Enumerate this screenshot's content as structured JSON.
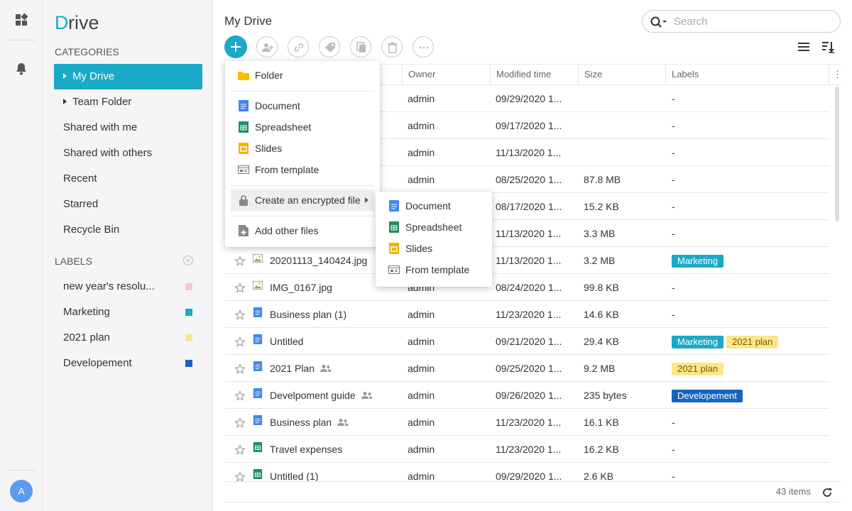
{
  "app": {
    "logo_text": "Drive",
    "user_initial": "A"
  },
  "colors": {
    "accent": "#1aa9c7",
    "marketing": "#1aa9c7",
    "plan2021": "#fde68a",
    "developement": "#1565c0",
    "newyear": "#f8c8c8"
  },
  "sidebar": {
    "categories_title": "CATEGORIES",
    "nav": [
      {
        "label": "My Drive",
        "active": true,
        "expandable": true
      },
      {
        "label": "Team Folder",
        "expandable": true
      },
      {
        "label": "Shared with me"
      },
      {
        "label": "Shared with others"
      },
      {
        "label": "Recent"
      },
      {
        "label": "Starred"
      },
      {
        "label": "Recycle Bin"
      }
    ],
    "labels_title": "LABELS",
    "labels": [
      {
        "label": "new year's resolu...",
        "color": "#f8c8c8"
      },
      {
        "label": "Marketing",
        "color": "#1aa9c7"
      },
      {
        "label": "2021 plan",
        "color": "#fde68a"
      },
      {
        "label": "Developement",
        "color": "#1565c0"
      }
    ]
  },
  "main": {
    "title": "My Drive",
    "search_placeholder": "Search",
    "columns": {
      "owner": "Owner",
      "modified": "Modified time",
      "size": "Size",
      "labels": "Labels"
    },
    "rows": [
      {
        "name": "",
        "type": "folder",
        "owner": "admin",
        "modified": "09/29/2020 1...",
        "size": "",
        "labels": []
      },
      {
        "name": "",
        "type": "folder",
        "owner": "admin",
        "modified": "09/17/2020 1...",
        "size": "",
        "labels": []
      },
      {
        "name": "",
        "type": "folder",
        "owner": "admin",
        "modified": "11/13/2020 1...",
        "size": "",
        "labels": []
      },
      {
        "name": "",
        "type": "doc",
        "owner": "admin",
        "modified": "08/25/2020 1...",
        "size": "87.8 MB",
        "labels": []
      },
      {
        "name": "",
        "type": "doc",
        "owner": "admin",
        "modified": "08/17/2020 1...",
        "size": "15.2 KB",
        "labels": []
      },
      {
        "name": "",
        "type": "doc",
        "owner": "admin",
        "modified": "11/13/2020 1...",
        "size": "3.3 MB",
        "labels": []
      },
      {
        "name": "20201113_140424.jpg",
        "type": "image",
        "owner": "admin",
        "modified": "11/13/2020 1...",
        "size": "3.2 MB",
        "labels": [
          "Marketing"
        ]
      },
      {
        "name": "IMG_0167.jpg",
        "type": "image",
        "owner": "admin",
        "modified": "08/24/2020 1...",
        "size": "99.8 KB",
        "labels": []
      },
      {
        "name": "Business plan (1)",
        "type": "doc",
        "owner": "admin",
        "modified": "11/23/2020 1...",
        "size": "14.6 KB",
        "labels": []
      },
      {
        "name": "Untitled",
        "type": "doc",
        "owner": "admin",
        "modified": "09/21/2020 1...",
        "size": "29.4 KB",
        "labels": [
          "Marketing",
          "2021 plan"
        ]
      },
      {
        "name": "2021 Plan",
        "type": "doc",
        "shared": true,
        "owner": "admin",
        "modified": "09/25/2020 1...",
        "size": "9.2 MB",
        "labels": [
          "2021 plan"
        ]
      },
      {
        "name": "Develpoment guide",
        "type": "doc",
        "shared": true,
        "owner": "admin",
        "modified": "09/26/2020 1...",
        "size": "235 bytes",
        "labels": [
          "Developement"
        ]
      },
      {
        "name": "Business plan",
        "type": "doc",
        "shared": true,
        "owner": "admin",
        "modified": "11/23/2020 1...",
        "size": "16.1 KB",
        "labels": []
      },
      {
        "name": "Travel expenses",
        "type": "sheet",
        "owner": "admin",
        "modified": "11/23/2020 1...",
        "size": "16.2 KB",
        "labels": []
      },
      {
        "name": "Untitled (1)",
        "type": "sheet",
        "owner": "admin",
        "modified": "09/29/2020 1...",
        "size": "2.6 KB",
        "labels": []
      }
    ],
    "empty_label": "-",
    "item_count": "43 items"
  },
  "new_menu": {
    "items": [
      {
        "label": "Folder",
        "icon": "folder-icon"
      },
      {
        "label": "Document",
        "icon": "document-icon"
      },
      {
        "label": "Spreadsheet",
        "icon": "spreadsheet-icon"
      },
      {
        "label": "Slides",
        "icon": "slides-icon"
      },
      {
        "label": "From template",
        "icon": "template-icon"
      },
      {
        "label": "Create an encrypted file",
        "icon": "lock-icon"
      },
      {
        "label": "Add other files",
        "icon": "upload-icon"
      }
    ]
  },
  "sub_menu": {
    "items": [
      {
        "label": "Document",
        "icon": "document-icon"
      },
      {
        "label": "Spreadsheet",
        "icon": "spreadsheet-icon"
      },
      {
        "label": "Slides",
        "icon": "slides-icon"
      },
      {
        "label": "From template",
        "icon": "template-icon"
      }
    ]
  }
}
